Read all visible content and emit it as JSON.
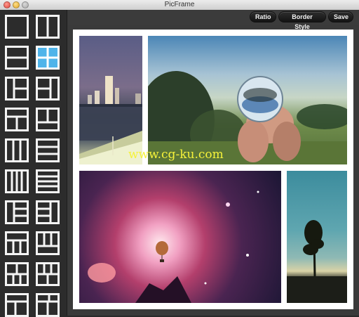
{
  "window": {
    "title": "PicFrame"
  },
  "toolbar": {
    "ratio_label": "Ratio",
    "border_style_label": "Border Style",
    "save_label": "Save"
  },
  "sidebar": {
    "templates_count_visible": 24,
    "selected_template_index": 3
  },
  "canvas": {
    "photos": [
      {
        "name": "city-skyline-at-dusk"
      },
      {
        "name": "hand-holding-glass-marble"
      },
      {
        "name": "pink-nebula-with-balloon"
      },
      {
        "name": "lone-tree-silhouette"
      }
    ],
    "watermark": "www.cg-ku.com"
  }
}
